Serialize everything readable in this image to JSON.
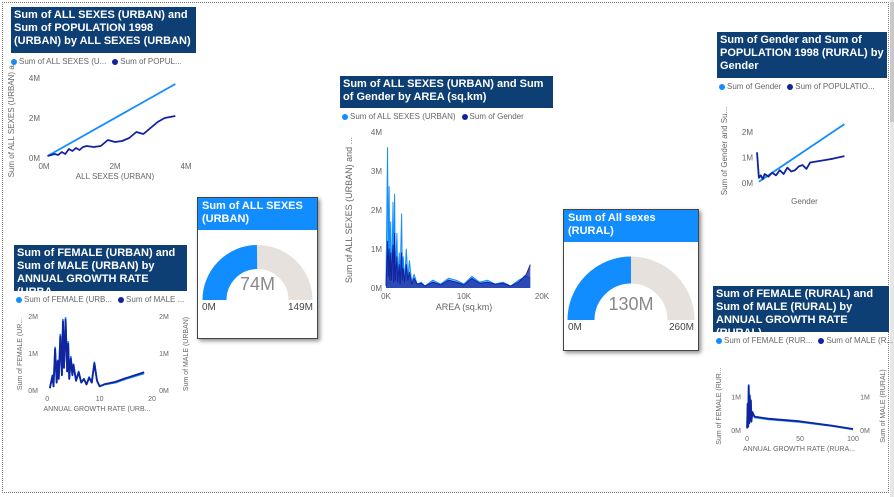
{
  "colors": {
    "series1": "#118dff",
    "series2": "#12239e",
    "gauge_bg": "#e6e1dc",
    "title_bg": "#0e3f74"
  },
  "chart_data": [
    {
      "id": "c1",
      "type": "line",
      "title": "Sum of ALL SEXES (URBAN) and Sum of POPULATION 1998 (URBAN) by ALL SEXES (URBAN)",
      "legend": [
        "Sum of ALL SEXES (U...",
        "Sum of POPUL..."
      ],
      "xlabel": "ALL SEXES (URBAN)",
      "ylabel": "Sum of ALL SEXES (URBAN) a...",
      "xlim": [
        0,
        4
      ],
      "ylim": [
        0,
        4
      ],
      "xticks": [
        "0M",
        "2M",
        "4M"
      ],
      "yticks": [
        "0M",
        "2M",
        "4M"
      ],
      "series": [
        {
          "name": "Sum of ALL SEXES (URBAN)",
          "x": [
            0.1,
            3.7
          ],
          "y": [
            0.1,
            3.7
          ]
        },
        {
          "name": "Sum of POPULATION 1998 (URBAN)",
          "x": [
            0.1,
            0.3,
            0.4,
            0.5,
            0.6,
            0.7,
            0.8,
            0.9,
            1.0,
            1.1,
            1.2,
            1.4,
            1.6,
            1.8,
            2.0,
            2.2,
            2.4,
            2.6,
            2.8,
            3.0,
            3.2,
            3.4,
            3.7
          ],
          "y": [
            0.1,
            0.2,
            0.15,
            0.3,
            0.2,
            0.45,
            0.35,
            0.5,
            0.4,
            0.55,
            0.6,
            0.55,
            0.6,
            0.9,
            0.8,
            0.85,
            1.0,
            1.3,
            1.2,
            1.5,
            1.8,
            2.0,
            2.1
          ]
        }
      ]
    },
    {
      "id": "c2",
      "type": "area",
      "title": "Sum of ALL SEXES (URBAN) and Sum of Gender by AREA (sq.km)",
      "legend": [
        "Sum of ALL SEXES (URBAN)",
        "Sum of Gender"
      ],
      "xlabel": "AREA (sq.km)",
      "ylabel": "Sum of ALL SEXES (URBAN) and ...",
      "xlim": [
        0,
        20000
      ],
      "ylim": [
        0,
        4
      ],
      "xticks": [
        "0K",
        "10K",
        "20K"
      ],
      "yticks": [
        "0M",
        "1M",
        "2M",
        "3M",
        "4M"
      ],
      "series": [
        {
          "name": "Sum of ALL SEXES (URBAN)",
          "x": [
            0,
            200,
            300,
            400,
            500,
            600,
            700,
            800,
            900,
            1000,
            1100,
            1200,
            1400,
            1500,
            1700,
            1800,
            2000,
            2100,
            2200,
            2400,
            2600,
            2800,
            3000,
            3300,
            3600,
            4000,
            4500,
            5000,
            6000,
            7000,
            8000,
            9000,
            10000,
            11000,
            12000,
            13000,
            14000,
            15000,
            16000,
            17000,
            18000,
            18500
          ],
          "y": [
            0.05,
            3.6,
            0.4,
            2.6,
            0.3,
            1.7,
            0.25,
            1.0,
            2.2,
            0.2,
            2.4,
            0.3,
            1.4,
            0.2,
            0.9,
            0.15,
            1.9,
            0.3,
            0.8,
            0.2,
            1.0,
            0.25,
            0.7,
            0.15,
            0.35,
            0.1,
            0.15,
            0.05,
            0.2,
            0.1,
            0.25,
            0.2,
            0.1,
            0.3,
            0.15,
            0.2,
            0.1,
            0.15,
            0.05,
            0.2,
            0.3,
            0.25
          ]
        },
        {
          "name": "Sum of Gender",
          "x": [
            0,
            200,
            300,
            400,
            500,
            600,
            700,
            800,
            900,
            1000,
            1100,
            1200,
            1400,
            1500,
            1700,
            1800,
            2000,
            2100,
            2200,
            2400,
            2600,
            2800,
            3000,
            3300,
            3600,
            4000,
            4500,
            5000,
            6000,
            7000,
            8000,
            9000,
            10000,
            11000,
            12000,
            13000,
            14000,
            15000,
            16000,
            17000,
            18000,
            18500
          ],
          "y": [
            0.05,
            1.2,
            0.3,
            1.0,
            0.2,
            0.9,
            0.2,
            0.7,
            1.1,
            0.15,
            1.4,
            0.2,
            0.8,
            0.15,
            0.6,
            0.1,
            0.9,
            0.2,
            0.5,
            0.15,
            0.6,
            0.2,
            0.4,
            0.1,
            0.25,
            0.1,
            0.12,
            0.05,
            0.15,
            0.08,
            0.2,
            0.15,
            0.08,
            0.25,
            0.12,
            0.15,
            0.1,
            0.12,
            0.05,
            0.15,
            0.35,
            0.6
          ]
        }
      ]
    },
    {
      "id": "c3",
      "type": "line",
      "title": "Sum of Gender and Sum of POPULATION 1998 (RURAL) by Gender",
      "legend": [
        "Sum of Gender",
        "Sum of POPULATIO..."
      ],
      "xlabel": "Gender",
      "ylabel": "Sum of Gender and Su...",
      "xlim": [
        0,
        2.5
      ],
      "ylim": [
        0,
        2.5
      ],
      "xticks": [],
      "yticks": [
        "0M",
        "1M",
        "2M"
      ],
      "series": [
        {
          "name": "Sum of Gender",
          "x": [
            0.05,
            2.3
          ],
          "y": [
            0.05,
            2.3
          ]
        },
        {
          "name": "Sum of POPULATION 1998 (RURAL)",
          "x": [
            0,
            0.05,
            0.1,
            0.15,
            0.2,
            0.3,
            0.4,
            0.5,
            0.6,
            0.7,
            0.8,
            0.9,
            1.0,
            1.1,
            1.2,
            1.3,
            1.4,
            1.6,
            1.8,
            2.0,
            2.3
          ],
          "y": [
            1.2,
            0.2,
            0.3,
            0.15,
            0.35,
            0.25,
            0.4,
            0.3,
            0.5,
            0.35,
            0.6,
            0.45,
            0.5,
            0.65,
            0.7,
            0.55,
            0.8,
            0.85,
            0.9,
            0.95,
            1.05
          ]
        }
      ]
    },
    {
      "id": "c4",
      "type": "line",
      "title": "Sum of FEMALE (URBAN) and Sum of MALE (URBAN) by ANNUAL GROWTH RATE (URBA...",
      "legend": [
        "Sum of FEMALE (URB...",
        "Sum of MALE ..."
      ],
      "xlabel": "ANNUAL GROWTH RATE (URB...",
      "ylabel": "Sum of FEMALE (UR...",
      "y2label": "Sum of MALE (URBAN)",
      "xlim": [
        -1,
        20
      ],
      "ylim": [
        0,
        2
      ],
      "xticks": [
        "0",
        "10",
        "20"
      ],
      "yticks": [
        "0M",
        "1M",
        "2M"
      ],
      "y2ticks": [
        "0M",
        "1M",
        "2M"
      ],
      "series": [
        {
          "name": "Sum of FEMALE (URBAN)",
          "x": [
            0.5,
            1.0,
            1.2,
            1.5,
            1.8,
            2.0,
            2.2,
            2.5,
            2.8,
            3.0,
            3.2,
            3.5,
            3.8,
            4.0,
            4.2,
            4.5,
            4.8,
            5.0,
            5.5,
            6.0,
            6.5,
            7.0,
            7.5,
            8.0,
            8.5,
            9.0,
            9.5,
            10,
            11,
            13,
            15,
            18.5
          ],
          "y": [
            0.05,
            0.4,
            0.1,
            1.15,
            0.2,
            0.8,
            0.3,
            1.5,
            0.4,
            1.9,
            0.6,
            1.95,
            0.5,
            1.3,
            0.3,
            0.9,
            0.4,
            0.7,
            0.25,
            0.5,
            0.2,
            0.3,
            0.15,
            0.35,
            0.2,
            0.75,
            0.25,
            0.1,
            0.15,
            0.2,
            0.3,
            0.45
          ]
        },
        {
          "name": "Sum of MALE (URBAN)",
          "x": [
            0.5,
            1.0,
            1.2,
            1.5,
            1.8,
            2.0,
            2.2,
            2.5,
            2.8,
            3.0,
            3.2,
            3.5,
            3.8,
            4.0,
            4.2,
            4.5,
            4.8,
            5.0,
            5.5,
            6.0,
            6.5,
            7.0,
            7.5,
            8.0,
            8.5,
            9.0,
            9.5,
            10,
            11,
            13,
            15,
            18.5
          ],
          "y": [
            0.05,
            0.38,
            0.1,
            1.1,
            0.2,
            0.78,
            0.3,
            1.45,
            0.4,
            1.85,
            0.6,
            1.9,
            0.5,
            1.25,
            0.3,
            0.85,
            0.4,
            0.68,
            0.25,
            0.48,
            0.2,
            0.3,
            0.15,
            0.33,
            0.2,
            0.72,
            0.25,
            0.1,
            0.16,
            0.22,
            0.32,
            0.48
          ]
        }
      ]
    },
    {
      "id": "c5",
      "type": "line",
      "title": "Sum of FEMALE (RURAL) and Sum of MALE (RURAL) by ANNUAL GROWTH RATE (RURAL)",
      "legend": [
        "Sum of FEMALE (RUR...",
        "Sum of MALE (R..."
      ],
      "xlabel": "ANNUAL GROWTH RATE (RURA...",
      "ylabel": "Sum of FEMALE (RUR...",
      "y2label": "Sum of MALE (RURAL)",
      "xlim": [
        -2,
        100
      ],
      "ylim": [
        0,
        1.5
      ],
      "xticks": [
        "0",
        "50",
        "100"
      ],
      "yticks": [
        "0M",
        "1M"
      ],
      "y2ticks": [
        "0M",
        "1M"
      ],
      "series": [
        {
          "name": "Sum of FEMALE (RURAL)",
          "x": [
            0,
            0.5,
            1,
            1.5,
            2,
            2.5,
            3,
            3.5,
            4,
            5,
            7,
            20,
            50,
            80,
            100
          ],
          "y": [
            0.05,
            0.8,
            0.1,
            1.35,
            0.2,
            1.05,
            0.3,
            0.9,
            0.25,
            0.55,
            0.38,
            0.32,
            0.24,
            0.12,
            0.02
          ]
        },
        {
          "name": "Sum of MALE (RURAL)",
          "x": [
            0,
            0.5,
            1,
            1.5,
            2,
            2.5,
            3,
            3.5,
            4,
            5,
            7,
            20,
            50,
            80,
            100
          ],
          "y": [
            0.05,
            0.78,
            0.1,
            1.32,
            0.2,
            1.02,
            0.3,
            0.88,
            0.25,
            0.53,
            0.4,
            0.34,
            0.26,
            0.13,
            0.03
          ]
        }
      ]
    }
  ],
  "gauges": [
    {
      "id": "g1",
      "title": "Sum of ALL SEXES (URBAN)",
      "value_label": "74M",
      "min_label": "0M",
      "max_label": "149M",
      "value": 74,
      "max": 149
    },
    {
      "id": "g2",
      "title": "Sum of All sexes (RURAL)",
      "value_label": "130M",
      "min_label": "0M",
      "max_label": "260M",
      "value": 130,
      "max": 260
    }
  ]
}
